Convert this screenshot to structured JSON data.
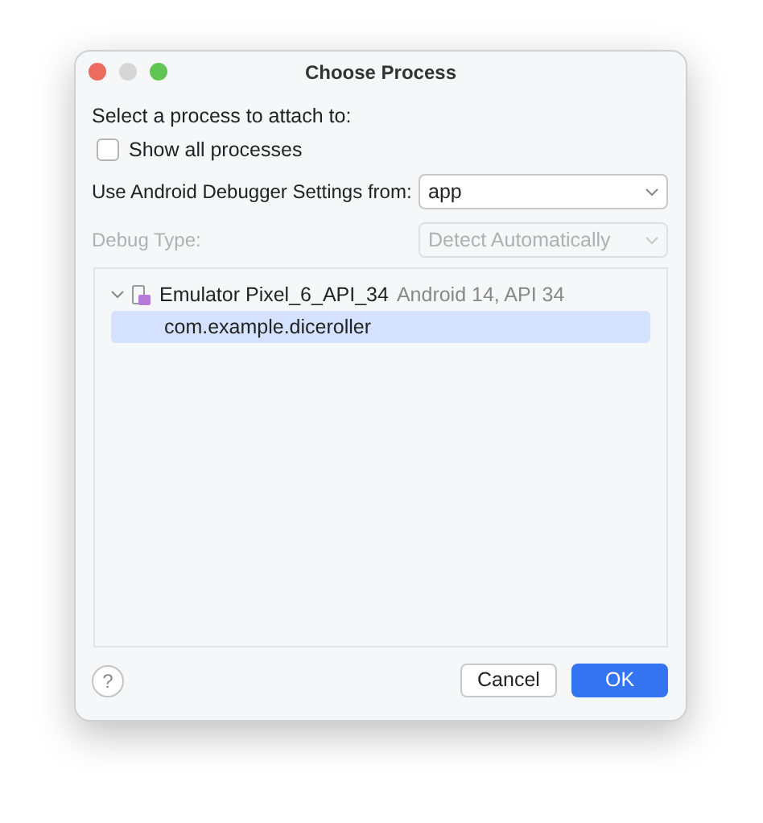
{
  "window": {
    "title": "Choose Process"
  },
  "prompt": "Select a process to attach to:",
  "show_all": {
    "label": "Show all processes",
    "checked": false
  },
  "fields": [
    {
      "label": "Use Android Debugger Settings from:",
      "value": "app",
      "disabled": false
    },
    {
      "label": "Debug Type:",
      "value": "Detect Automatically",
      "disabled": true
    }
  ],
  "tree": [
    {
      "label": "Emulator Pixel_6_API_34",
      "detail": "Android 14, API 34",
      "expanded": true,
      "selected": false,
      "children": [
        {
          "label": "com.example.diceroller",
          "selected": true
        }
      ]
    }
  ],
  "help": "?",
  "buttons": [
    {
      "label": "Cancel",
      "kind": "secondary"
    },
    {
      "label": "OK",
      "kind": "primary"
    }
  ]
}
